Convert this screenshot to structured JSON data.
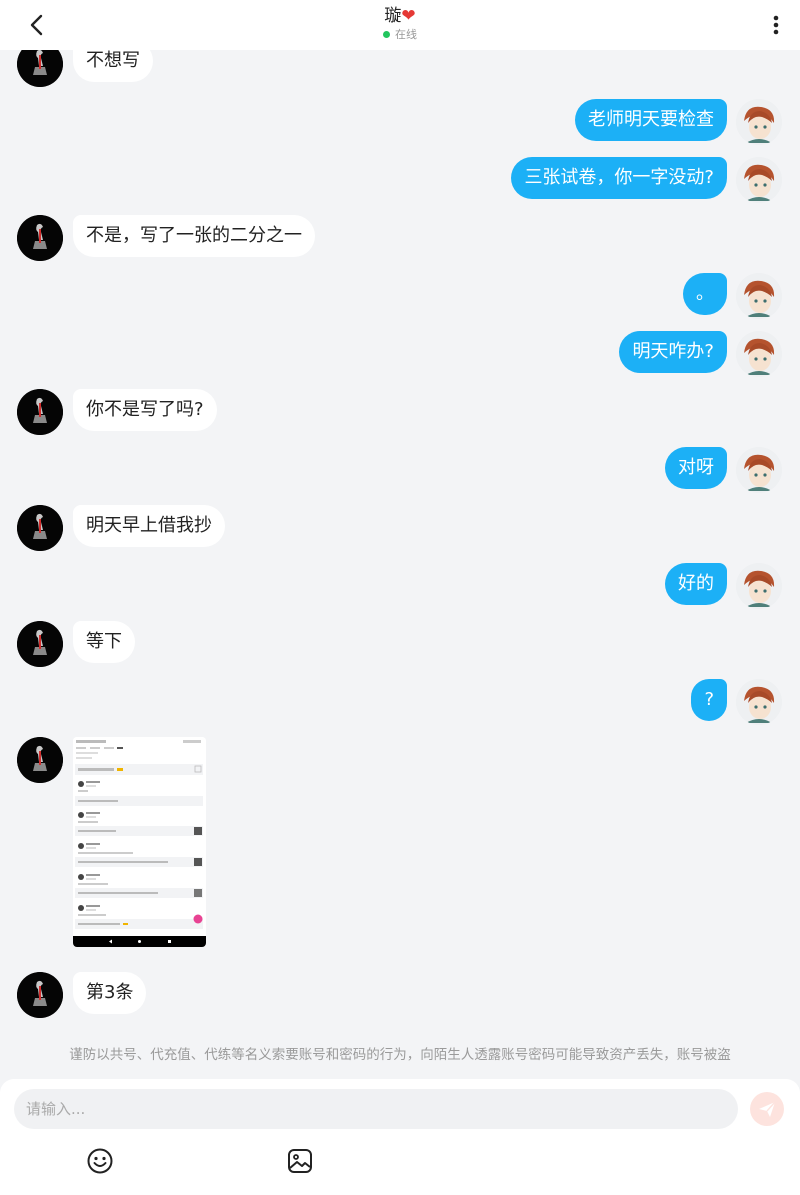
{
  "header": {
    "name": "璇",
    "heart": "❤",
    "status": "在线"
  },
  "messages": [
    {
      "side": "them",
      "text": "不想写"
    },
    {
      "side": "me",
      "text": "老师明天要检查"
    },
    {
      "side": "me",
      "text": "三张试卷，你一字没动?"
    },
    {
      "side": "them",
      "text": "不是，写了一张的二分之一"
    },
    {
      "side": "me",
      "text": "。"
    },
    {
      "side": "me",
      "text": "明天咋办?"
    },
    {
      "side": "them",
      "text": "你不是写了吗?"
    },
    {
      "side": "me",
      "text": "对呀"
    },
    {
      "side": "them",
      "text": "明天早上借我抄"
    },
    {
      "side": "me",
      "text": "好的"
    },
    {
      "side": "them",
      "text": "等下"
    },
    {
      "side": "me",
      "text": "?"
    },
    {
      "side": "them",
      "type": "image"
    },
    {
      "side": "them",
      "text": "第3条"
    }
  ],
  "notice": "谨防以共号、代充值、代练等名义索要账号和密码的行为，向陌生人透露账号密码可能导致资产丢失，账号被盗",
  "input": {
    "placeholder": "请输入..."
  },
  "icons": {
    "back": "chevron-left-icon",
    "more": "more-vertical-icon",
    "send": "send-icon",
    "emoji": "emoji-icon",
    "image": "image-icon"
  },
  "colors": {
    "my_bubble": "#1cb0f6",
    "their_bubble": "#ffffff",
    "online_dot": "#22c55e",
    "send_button": "#fde3de",
    "heart": "#e53935"
  }
}
